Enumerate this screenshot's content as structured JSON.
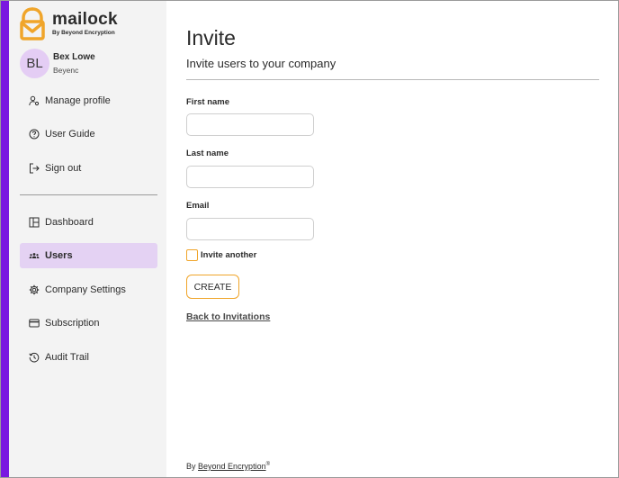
{
  "brand": {
    "name": "mailock",
    "tagline": "By Beyond Encryption",
    "accent_color": "#7a17e0",
    "logo_color": "#f0a52a"
  },
  "user": {
    "initials": "BL",
    "name": "Bex Lowe",
    "org": "Beyenc"
  },
  "sidebar": {
    "account_items": [
      {
        "label": "Manage profile",
        "icon": "user-gear-icon"
      },
      {
        "label": "User Guide",
        "icon": "help-circle-icon"
      },
      {
        "label": "Sign out",
        "icon": "sign-out-icon"
      }
    ],
    "main_items": [
      {
        "label": "Dashboard",
        "icon": "dashboard-icon"
      },
      {
        "label": "Users",
        "icon": "users-icon",
        "active": true
      },
      {
        "label": "Company Settings",
        "icon": "gear-icon"
      },
      {
        "label": "Subscription",
        "icon": "card-icon"
      },
      {
        "label": "Audit Trail",
        "icon": "history-icon"
      }
    ]
  },
  "main": {
    "title": "Invite",
    "subtitle": "Invite users to your company",
    "fields": {
      "first_name": {
        "label": "First name",
        "value": ""
      },
      "last_name": {
        "label": "Last name",
        "value": ""
      },
      "email": {
        "label": "Email",
        "value": ""
      }
    },
    "invite_another_label": "Invite another",
    "invite_another_checked": false,
    "create_label": "CREATE",
    "back_link": "Back to Invitations"
  },
  "footer": {
    "prefix": "By",
    "link": "Beyond Encryption",
    "mark": "®"
  }
}
